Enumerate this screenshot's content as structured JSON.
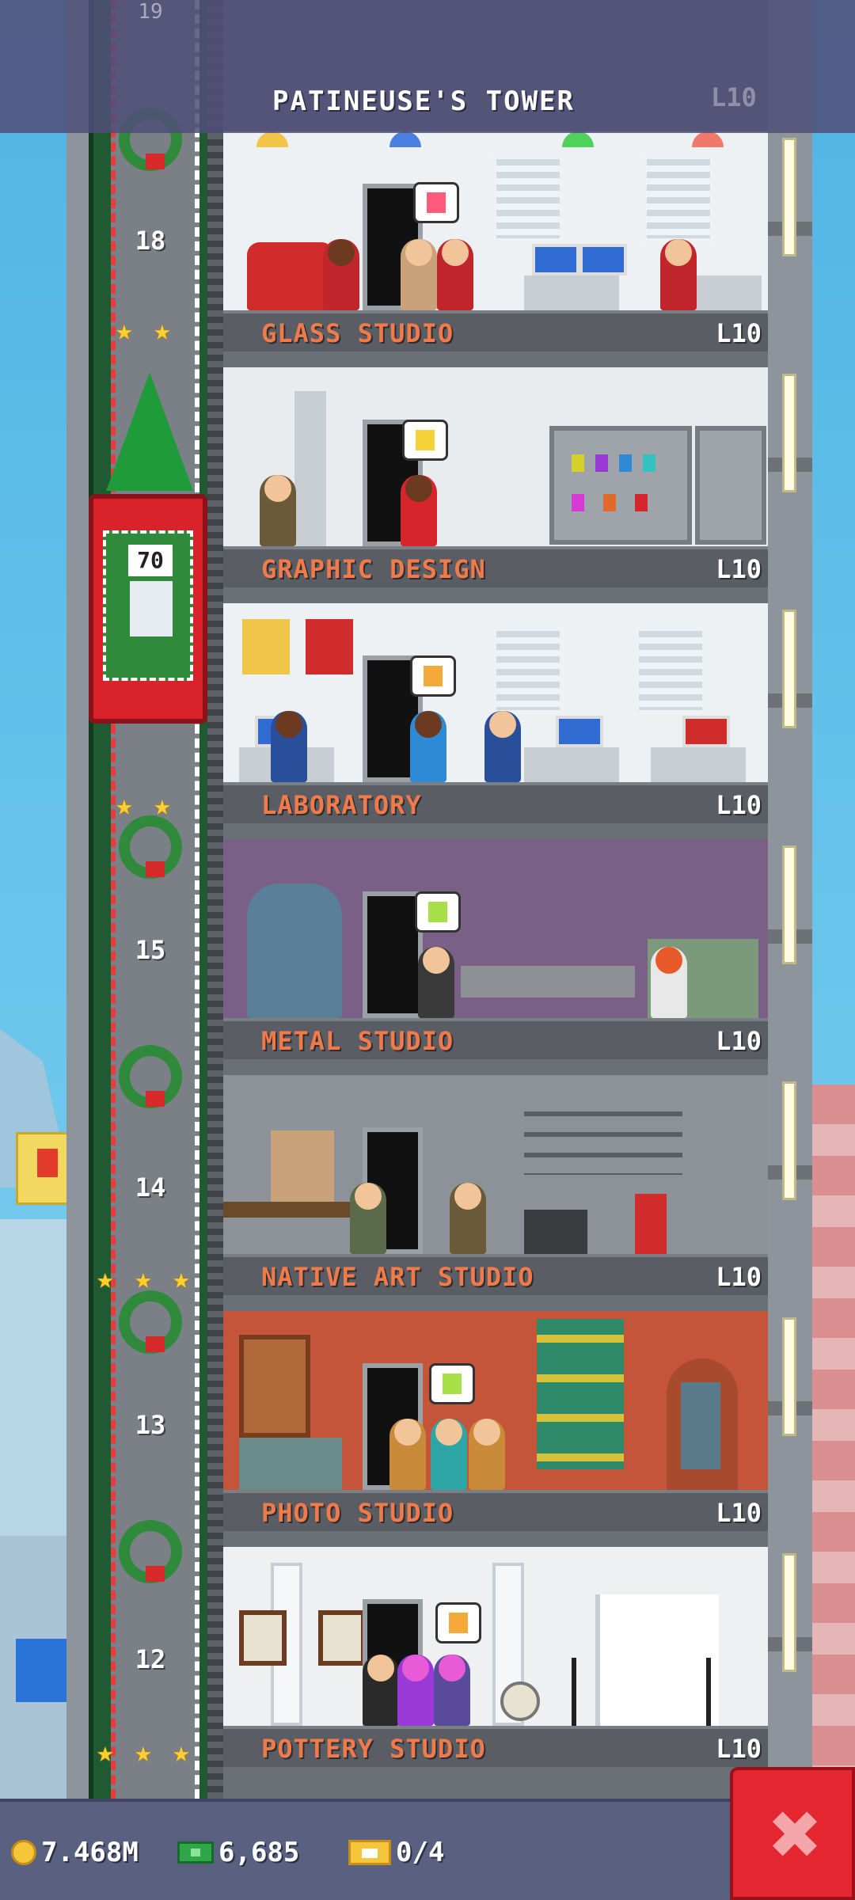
{
  "header": {
    "tower_name": "PATINEUSE'S TOWER",
    "level": "L10",
    "top_floor_number": "19"
  },
  "floors": [
    {
      "name": "GLASS STUDIO",
      "level": "L10",
      "wall_color": "#eef1f3",
      "floor_color": "#79c24a"
    },
    {
      "name": "GRAPHIC DESIGN",
      "level": "L10",
      "wall_color": "#e9ecef",
      "floor_color": "#9aa0a6"
    },
    {
      "name": "LABORATORY",
      "level": "L10",
      "wall_color": "#eef1f3",
      "floor_color": "#79c24a"
    },
    {
      "name": "METAL STUDIO",
      "level": "L10",
      "wall_color": "#7a5f86",
      "floor_color": "#8c9096"
    },
    {
      "name": "NATIVE ART STUDIO",
      "level": "L10",
      "wall_color": "#8d9298",
      "floor_color": "#6b6f76"
    },
    {
      "name": "PHOTO STUDIO",
      "level": "L10",
      "wall_color": "#c4553a",
      "floor_color": "#8a7a3a"
    },
    {
      "name": "POTTERY STUDIO",
      "level": "L10",
      "wall_color": "#eef0f2",
      "floor_color": "#9aa0a6"
    }
  ],
  "shaft_floor_numbers": [
    "18",
    "15",
    "14",
    "13",
    "12"
  ],
  "elevator": {
    "counter": "70",
    "car_color": "#d9232b"
  },
  "status_bar": {
    "coins": "7.468M",
    "bux": "6,685",
    "tickets": "0/4"
  },
  "close_button": {
    "label": "✖",
    "icon": "close-icon"
  },
  "colors": {
    "floor_label": "#f07a4a",
    "level_label": "#ffffff",
    "header_bg": "#504e78",
    "close_bg": "#e3262f"
  }
}
